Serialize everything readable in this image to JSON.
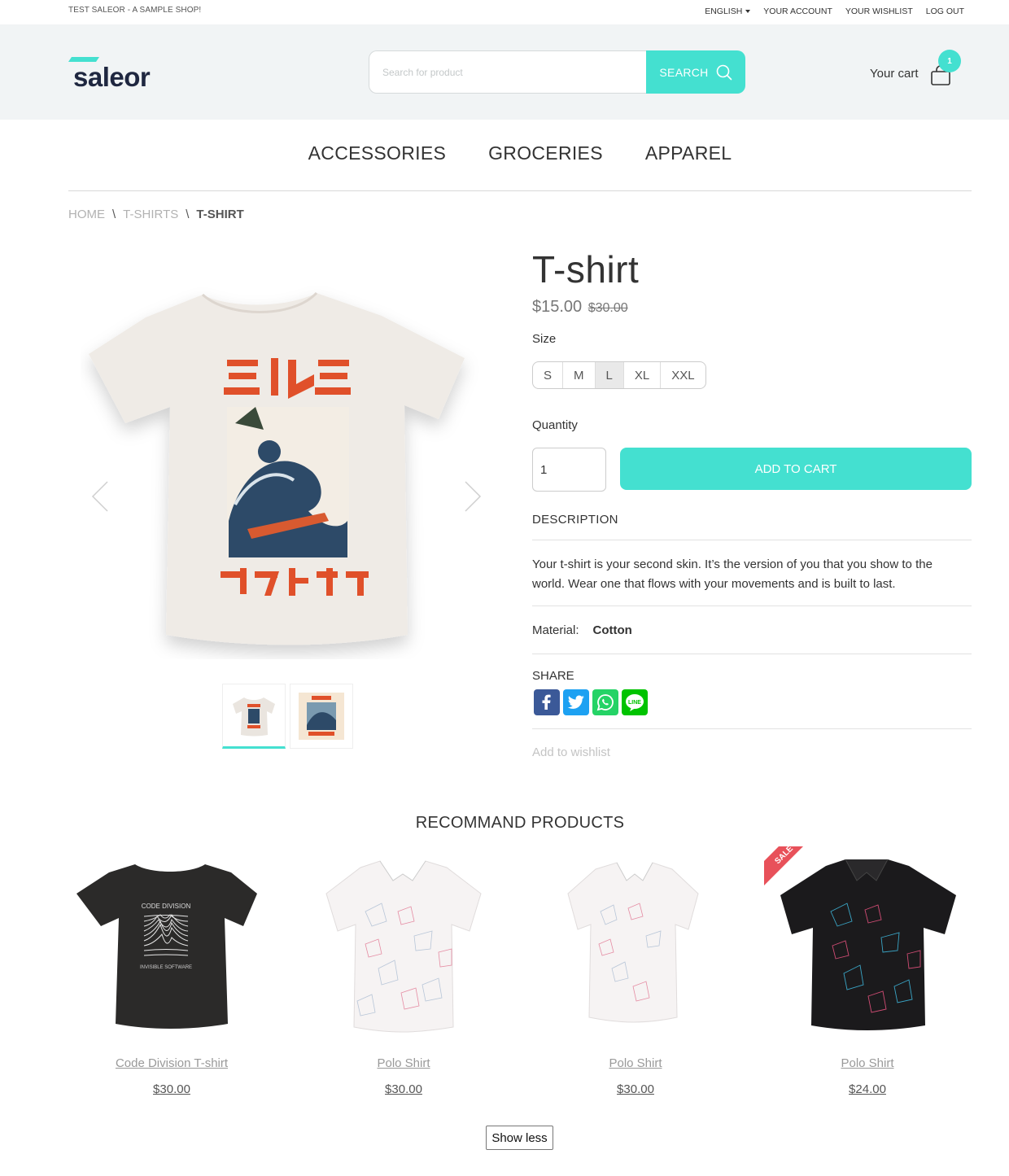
{
  "topbar": {
    "shop_name": "TEST SALEOR - A SAMPLE SHOP!",
    "language": "ENGLISH",
    "account": "YOUR ACCOUNT",
    "wishlist": "YOUR WISHLIST",
    "logout": "LOG OUT"
  },
  "header": {
    "logo_text": "saleor",
    "search_placeholder": "Search for product",
    "search_button": "SEARCH",
    "cart_label": "Your cart",
    "cart_count": "1"
  },
  "nav": {
    "items": [
      "ACCESSORIES",
      "GROCERIES",
      "APPAREL"
    ]
  },
  "breadcrumb": {
    "items": [
      "HOME",
      "T-SHIRTS",
      "T-SHIRT"
    ],
    "separator": "\\"
  },
  "product": {
    "title": "T-shirt",
    "price": "$15.00",
    "old_price": "$30.00",
    "size_label": "Size",
    "sizes": [
      "S",
      "M",
      "L",
      "XL",
      "XXL"
    ],
    "selected_size": "L",
    "quantity_label": "Quantity",
    "quantity_value": "1",
    "add_to_cart": "ADD TO CART",
    "description_heading": "DESCRIPTION",
    "description": "Your t-shirt is your second skin. It’s the version of you that you show to the world. Wear one that flows with your movements and is built to last.",
    "material_label": "Material:",
    "material_value": "Cotton",
    "share_heading": "SHARE",
    "share_icons": [
      "facebook-icon",
      "twitter-icon",
      "whatsapp-icon",
      "line-icon"
    ],
    "line_icon_text": "LINE",
    "add_to_wishlist": "Add to wishlist"
  },
  "recommended": {
    "title": "RECOMMAND PRODUCTS",
    "products": [
      {
        "name": "Code Division T-shirt",
        "price": "$30.00",
        "print_text": "CODE DIVISION",
        "print_subtext": "INVISIBLE SOFTWARE"
      },
      {
        "name": "Polo Shirt",
        "price": "$30.00"
      },
      {
        "name": "Polo Shirt",
        "price": "$30.00"
      },
      {
        "name": "Polo Shirt",
        "price": "$24.00",
        "badge": "SALE"
      }
    ],
    "show_less": "Show less"
  },
  "colors": {
    "accent": "#44e0d0",
    "header_bg": "#f1f4f5",
    "logo_dark": "#1f2740",
    "sale_red": "#e8515a",
    "facebook": "#3b5998",
    "twitter": "#1da1f2",
    "whatsapp": "#25d366",
    "line": "#00c300"
  }
}
